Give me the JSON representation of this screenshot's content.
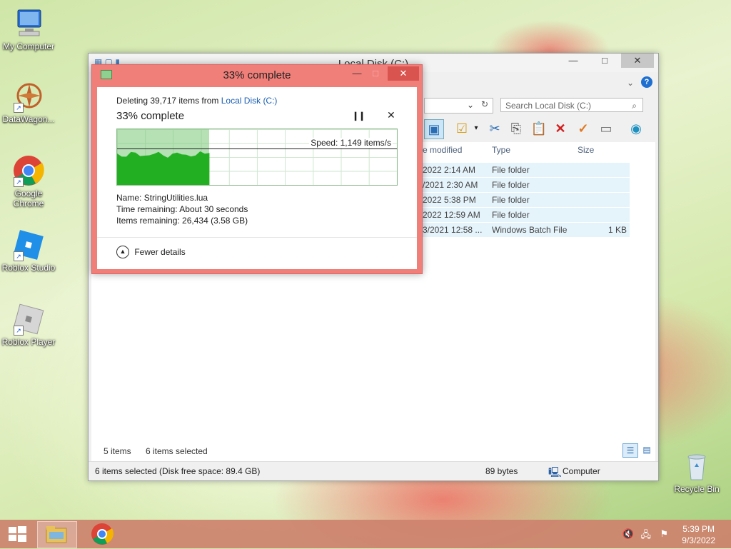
{
  "desktop": {
    "icons": [
      {
        "label": "My Computer"
      },
      {
        "label": "DataWagon..."
      },
      {
        "label": "Google Chrome"
      },
      {
        "label": "Roblox Studio"
      },
      {
        "label": "Roblox Player"
      },
      {
        "label": "Recycle Bin"
      }
    ]
  },
  "explorer": {
    "title": "Local Disk (C:)",
    "search_placeholder": "Search Local Disk (C:)",
    "columns": {
      "modified": "e modified",
      "type": "Type",
      "size": "Size"
    },
    "rows": [
      {
        "date": "2022 2:14 AM",
        "type": "File folder",
        "size": ""
      },
      {
        "date": "/2021 2:30 AM",
        "type": "File folder",
        "size": ""
      },
      {
        "date": "2022 5:38 PM",
        "type": "File folder",
        "size": ""
      },
      {
        "date": "2022 12:59 AM",
        "type": "File folder",
        "size": ""
      },
      {
        "date": "3/2021 12:58 ...",
        "type": "Windows Batch File",
        "size": "1 KB"
      }
    ],
    "status_items": "5 items",
    "status_selected": "6 items selected",
    "bottom_selected": "6 items selected (Disk free space: 89.4 GB)",
    "bottom_size": "89 bytes",
    "bottom_location": "Computer"
  },
  "dialog": {
    "title": "33% complete",
    "deleting_prefix": "Deleting 39,717 items from",
    "deleting_location": "Local Disk (C:)",
    "heading": "33% complete",
    "progress_percent": 33,
    "speed": "Speed: 1,149 items/s",
    "name_label": "Name:",
    "name_value": "StringUtilities.lua",
    "time_label": "Time remaining:",
    "time_value": "About 30 seconds",
    "items_label": "Items remaining:",
    "items_value": "26,434 (3.58 GB)",
    "fewer_details": "Fewer details"
  },
  "taskbar": {
    "time": "5:39 PM",
    "date": "9/3/2022"
  },
  "colors": {
    "dialog_frame": "#f07f79",
    "progress_green": "#22b022",
    "link_blue": "#1a5fb4"
  }
}
